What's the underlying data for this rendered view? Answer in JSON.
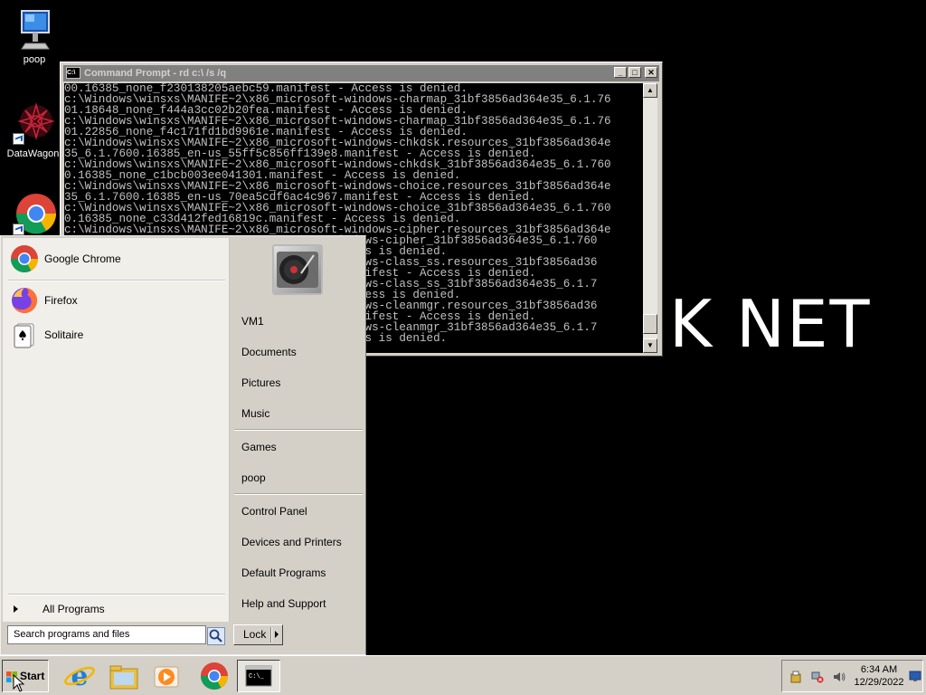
{
  "desktop": {
    "icons": [
      {
        "label": "poop",
        "icon": "computer-icon"
      },
      {
        "label": "DataWagon.",
        "icon": "datawagon-icon"
      },
      {
        "label": "",
        "icon": "chrome-icon"
      }
    ],
    "watermark": "K NET"
  },
  "cmd": {
    "title": "Command Prompt - rd  c:\\ /s /q",
    "lines": [
      "00.16385_none_f230138205aebc59.manifest - Access is denied.",
      "c:\\Windows\\winsxs\\MANIFE~2\\x86_microsoft-windows-charmap_31bf3856ad364e35_6.1.76",
      "01.18648_none_f444a3cc02b20fea.manifest - Access is denied.",
      "c:\\Windows\\winsxs\\MANIFE~2\\x86_microsoft-windows-charmap_31bf3856ad364e35_6.1.76",
      "01.22856_none_f4c171fd1bd9961e.manifest - Access is denied.",
      "c:\\Windows\\winsxs\\MANIFE~2\\x86_microsoft-windows-chkdsk.resources_31bf3856ad364e",
      "35_6.1.7600.16385_en-us_55ff5c856ff139e8.manifest - Access is denied.",
      "c:\\Windows\\winsxs\\MANIFE~2\\x86_microsoft-windows-chkdsk_31bf3856ad364e35_6.1.760",
      "0.16385_none_c1bcb003ee041301.manifest - Access is denied.",
      "c:\\Windows\\winsxs\\MANIFE~2\\x86_microsoft-windows-choice.resources_31bf3856ad364e",
      "35_6.1.7600.16385_en-us_70ea5cdf6ac4c967.manifest - Access is denied.",
      "c:\\Windows\\winsxs\\MANIFE~2\\x86_microsoft-windows-choice_31bf3856ad364e35_6.1.760",
      "0.16385_none_c33d412fed16819c.manifest - Access is denied.",
      "c:\\Windows\\winsxs\\MANIFE~2\\x86_microsoft-windows-cipher.resources_31bf3856ad364e",
      "                                       windows-cipher_31bf3856ad364e35_6.1.760",
      "                                       Access is denied.",
      "                                       windows-class_ss.resources_31bf3856ad36",
      "                                       3.manifest - Access is denied.",
      "                                       windows-class_ss_31bf3856ad364e35_6.1.7",
      "                                       - Access is denied.",
      "                                       windows-cleanmgr.resources_31bf3856ad36",
      "                                       4.manifest - Access is denied.",
      "                                       windows-cleanmgr_31bf3856ad364e35_6.1.7",
      "                                       Access is denied."
    ]
  },
  "start_menu": {
    "programs": [
      {
        "label": "Google Chrome",
        "icon": "chrome-icon"
      },
      {
        "label": "Firefox",
        "icon": "firefox-icon"
      },
      {
        "label": "Solitaire",
        "icon": "solitaire-icon"
      }
    ],
    "all_programs": "All Programs",
    "search_placeholder": "Search programs and files",
    "right_items": {
      "vm1": "VM1",
      "documents": "Documents",
      "pictures": "Pictures",
      "music": "Music",
      "games": "Games",
      "poop": "poop",
      "control_panel": "Control Panel",
      "devices_printers": "Devices and Printers",
      "default_programs": "Default Programs",
      "help_support": "Help and Support"
    },
    "lock_label": "Lock"
  },
  "taskbar": {
    "start_label": "Start",
    "pinned": [
      "ie-icon",
      "explorer-icon",
      "media-player-icon",
      "chrome-icon",
      "cmd-icon"
    ],
    "clock_time": "6:34 AM",
    "clock_date": "12/29/2022"
  }
}
